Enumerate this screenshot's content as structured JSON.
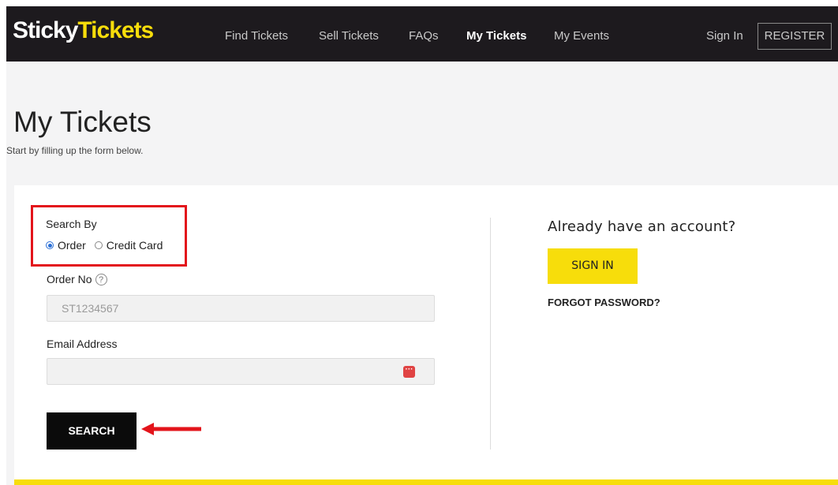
{
  "header": {
    "logo_part1": "Sticky",
    "logo_part2": "Tickets",
    "nav": [
      "Find Tickets",
      "Sell Tickets",
      "FAQs",
      "My Tickets",
      "My Events"
    ],
    "sign_in": "Sign In",
    "register": "REGISTER"
  },
  "page": {
    "title": "My Tickets",
    "subtitle": "Start by filling up the form below."
  },
  "form": {
    "search_by_label": "Search By",
    "option_order": "Order",
    "option_credit_card": "Credit Card",
    "selected_option": "Order",
    "order_no_label": "Order No",
    "help_icon": "?",
    "order_no_placeholder": "ST1234567",
    "order_no_value": "",
    "email_label": "Email Address",
    "email_value": "",
    "search_button": "SEARCH"
  },
  "account": {
    "heading": "Already have an account?",
    "sign_in_button": "SIGN IN",
    "forgot_password": "FORGOT PASSWORD?"
  },
  "colors": {
    "brand_yellow": "#f7dd0b",
    "nav_bg": "#1d1a1e",
    "annotation_red": "#e3141b",
    "radio_blue": "#2a6fd6"
  },
  "icons": {
    "help": "question-circle-icon",
    "password_manager": "password-manager-icon",
    "annotation_arrow": "left-arrow-icon"
  }
}
